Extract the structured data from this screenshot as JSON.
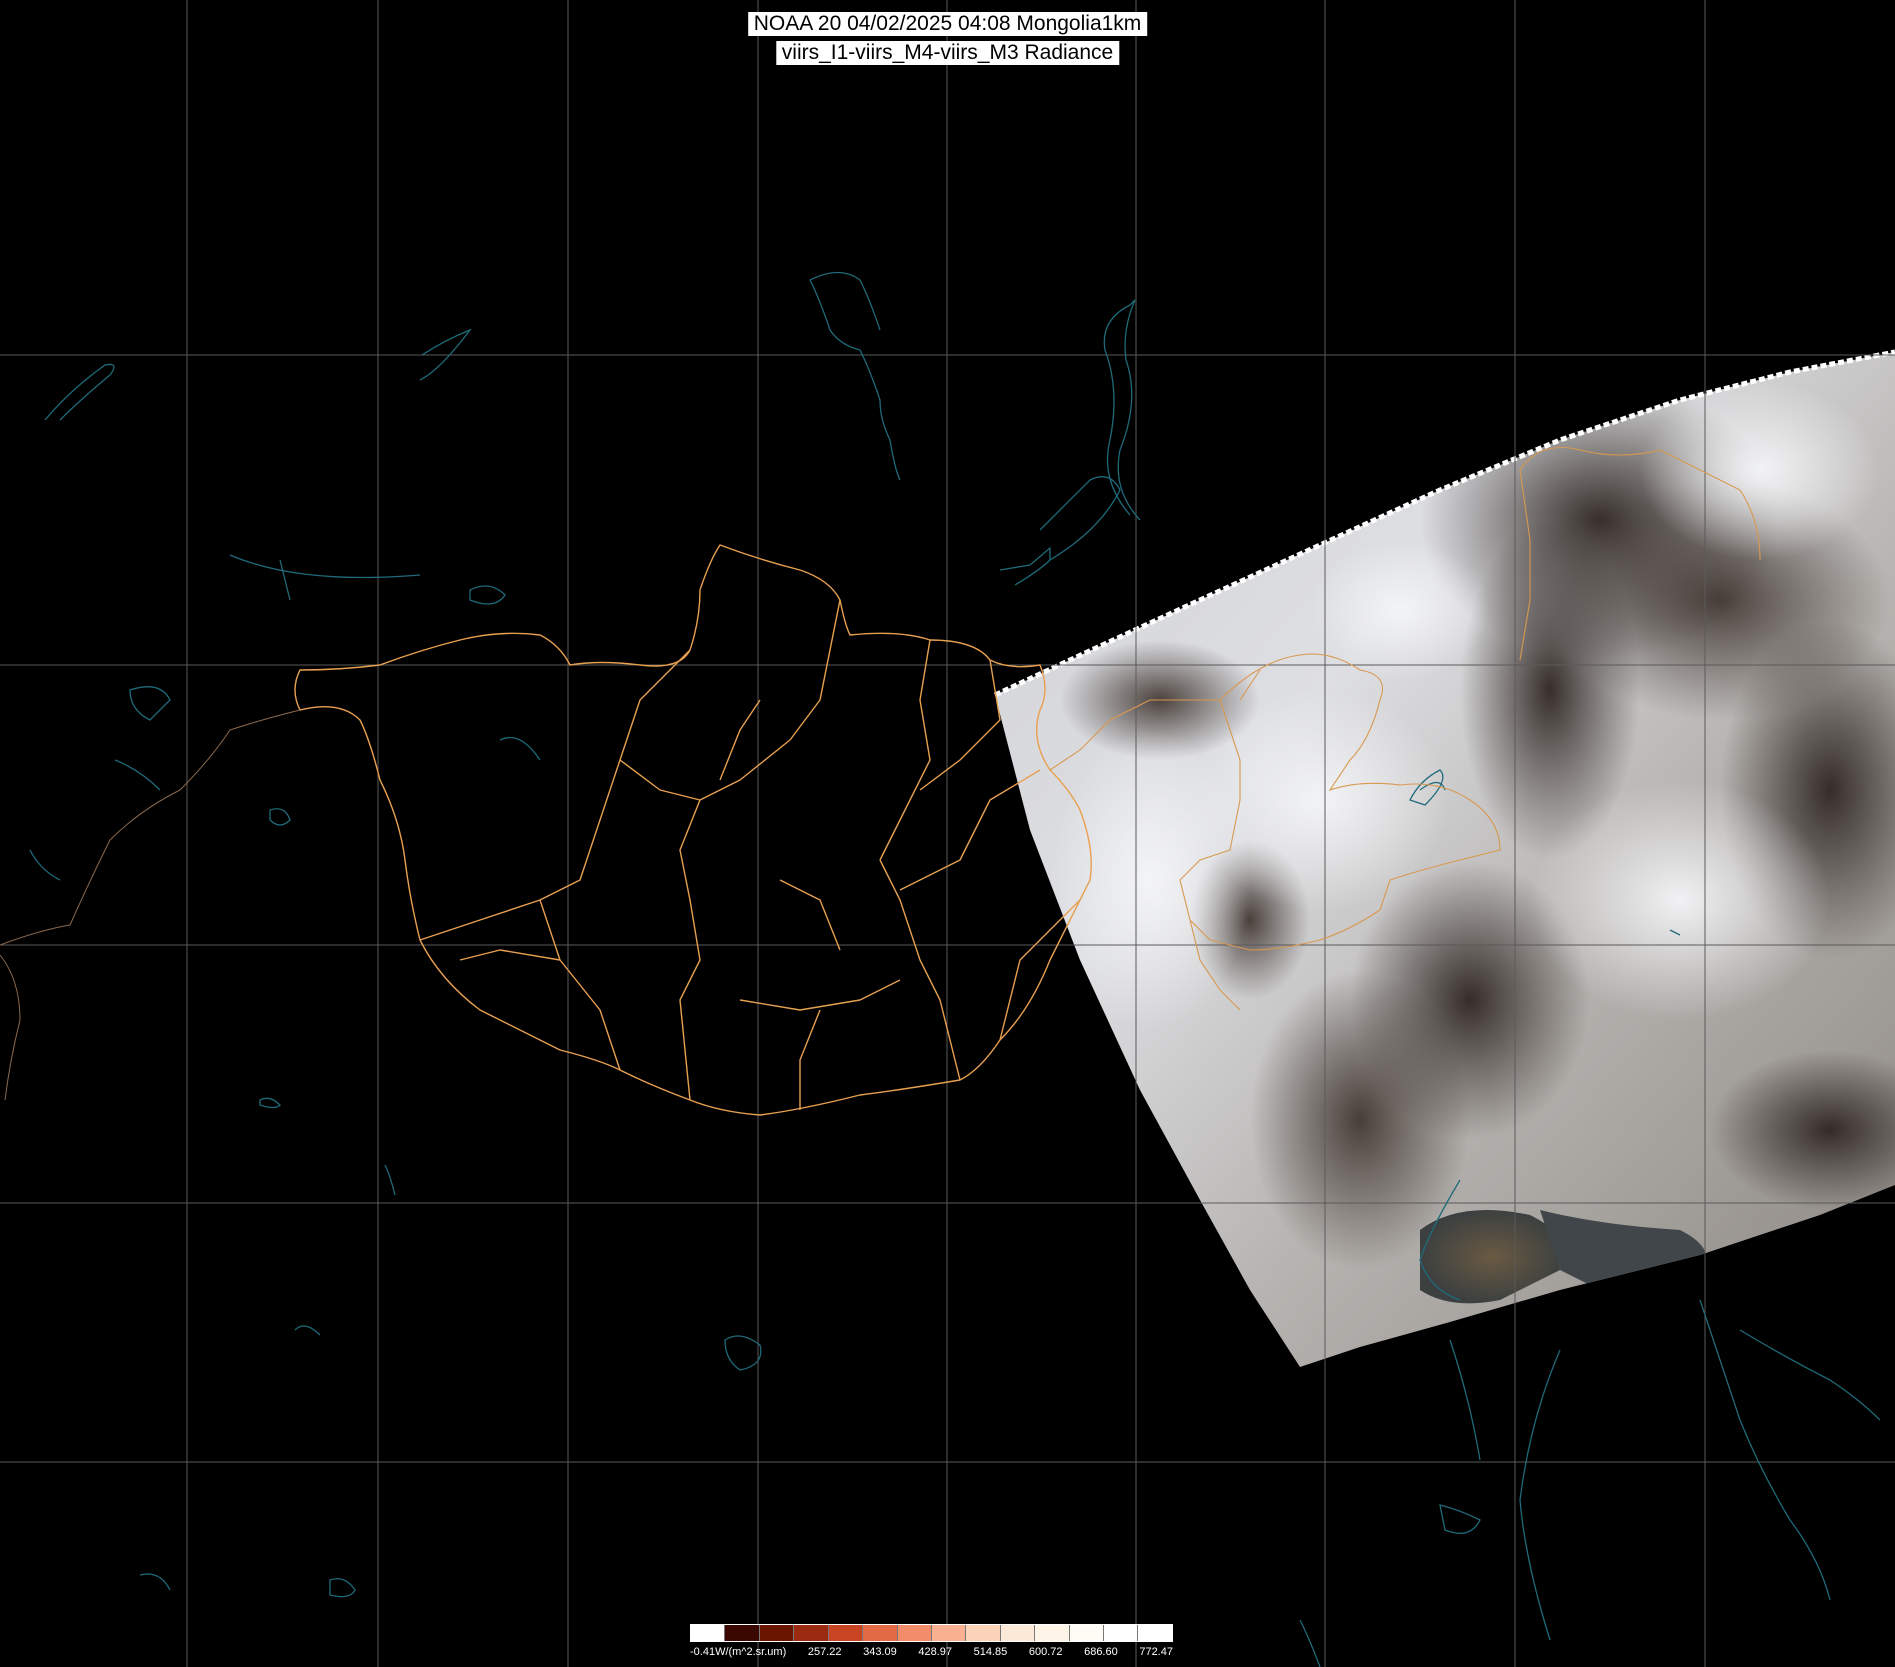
{
  "title": {
    "line1": "NOAA 20 04/02/2025 04:08 Mongolia1km",
    "line2": "viirs_I1-viirs_M4-viirs_M3 Radiance"
  },
  "legend": {
    "labels": [
      "-0.41W/(m^2.sr.um)",
      "257.22",
      "343.09",
      "428.97",
      "514.85",
      "600.72",
      "686.60",
      "772.47"
    ],
    "colors": [
      "#ffffff",
      "#3a0800",
      "#6a1500",
      "#9a2a10",
      "#c84422",
      "#e26a45",
      "#f28c68",
      "#f9b090",
      "#fcd3b8",
      "#fde9d8",
      "#fff4e8",
      "#fefdf5",
      "#ffffff",
      "#ffffff"
    ]
  },
  "colors": {
    "background": "#000000",
    "graticule": "#5a5a5a",
    "border": "#e8a050",
    "water": "#1f6a7a",
    "coast": "#1f6a7a"
  }
}
